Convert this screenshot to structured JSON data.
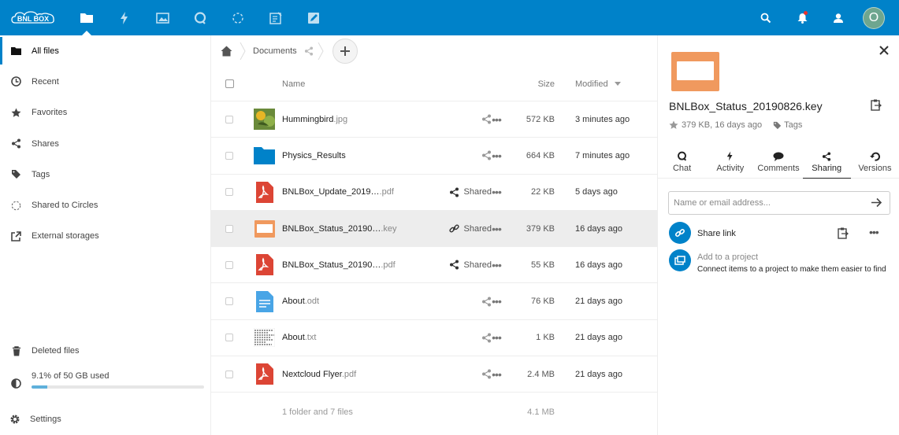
{
  "header": {
    "logo_text": "BNL BOX",
    "apps": [
      {
        "id": "files",
        "icon": "folder-icon",
        "active": true
      },
      {
        "id": "activity",
        "icon": "lightning-icon"
      },
      {
        "id": "gallery",
        "icon": "image-icon"
      },
      {
        "id": "talk",
        "icon": "chat-icon"
      },
      {
        "id": "circles",
        "icon": "circles-icon"
      },
      {
        "id": "tasks",
        "icon": "checklist-icon"
      },
      {
        "id": "notes",
        "icon": "pencil-icon"
      }
    ],
    "avatar_letter": "O",
    "bg_color": "#0082c9"
  },
  "nav": {
    "items": [
      {
        "label": "All files",
        "icon": "folder-icon",
        "active": true
      },
      {
        "label": "Recent",
        "icon": "clock-icon"
      },
      {
        "label": "Favorites",
        "icon": "star-icon"
      },
      {
        "label": "Shares",
        "icon": "share-icon"
      },
      {
        "label": "Tags",
        "icon": "tag-icon"
      },
      {
        "label": "Shared to Circles",
        "icon": "circles-icon"
      },
      {
        "label": "External storages",
        "icon": "external-icon"
      }
    ],
    "deleted_label": "Deleted files",
    "quota_label": "9.1% of 50 GB used",
    "quota_percent": 9.1,
    "settings_label": "Settings"
  },
  "breadcrumb": {
    "current": "Documents"
  },
  "list": {
    "col_name": "Name",
    "col_size": "Size",
    "col_modified": "Modified",
    "files": [
      {
        "base": "Hummingbird",
        "ext": ".jpg",
        "type": "image",
        "shared": "",
        "size": "572 KB",
        "modified": "3 minutes ago"
      },
      {
        "base": "Physics_Results",
        "ext": "",
        "type": "folder",
        "shared": "",
        "size": "664 KB",
        "modified": "7 minutes ago"
      },
      {
        "base": "BNLBox_Update_2019…",
        "ext": ".pdf",
        "type": "pdf",
        "shared": "Shared",
        "size": "22 KB",
        "modified": "5 days ago"
      },
      {
        "base": "BNLBox_Status_20190…",
        "ext": ".key",
        "type": "key",
        "shared": "Shared",
        "share_kind": "link",
        "size": "379 KB",
        "modified": "16 days ago",
        "selected": true
      },
      {
        "base": "BNLBox_Status_20190…",
        "ext": ".pdf",
        "type": "pdf",
        "shared": "Shared",
        "size": "55 KB",
        "modified": "16 days ago"
      },
      {
        "base": "About",
        "ext": ".odt",
        "type": "doc",
        "shared": "",
        "size": "76 KB",
        "modified": "21 days ago"
      },
      {
        "base": "About",
        "ext": ".txt",
        "type": "txt",
        "shared": "",
        "size": "1 KB",
        "modified": "21 days ago"
      },
      {
        "base": "Nextcloud Flyer",
        "ext": ".pdf",
        "type": "pdf",
        "shared": "",
        "size": "2.4 MB",
        "modified": "21 days ago"
      }
    ],
    "summary_label": "1 folder and 7 files",
    "summary_size": "4.1 MB"
  },
  "sidebar": {
    "title": "BNLBox_Status_20190826.key",
    "meta": "379 KB, 16 days ago",
    "tags_label": "Tags",
    "tabs": [
      {
        "label": "Chat",
        "icon": "chat-icon"
      },
      {
        "label": "Activity",
        "icon": "lightning-icon"
      },
      {
        "label": "Comments",
        "icon": "comment-icon"
      },
      {
        "label": "Sharing",
        "icon": "share-icon",
        "active": true
      },
      {
        "label": "Versions",
        "icon": "history-icon"
      }
    ],
    "share_placeholder": "Name or email address...",
    "share_link_label": "Share link",
    "project_title": "Add to a project",
    "project_desc": "Connect items to a project to make them easier to find"
  }
}
